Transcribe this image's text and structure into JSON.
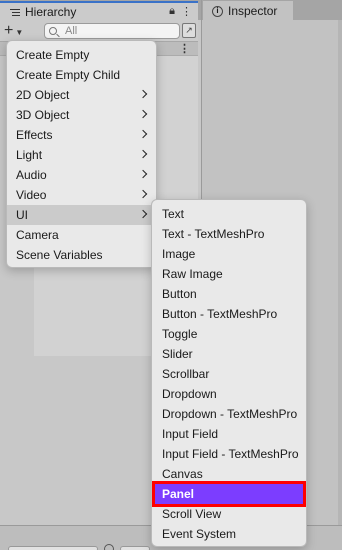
{
  "tabs": {
    "hierarchy": "Hierarchy",
    "inspector": "Inspector"
  },
  "toolbar": {
    "search_placeholder": "All"
  },
  "create_menu": {
    "items": [
      {
        "label": "Create Empty",
        "submenu": false
      },
      {
        "label": "Create Empty Child",
        "submenu": false
      },
      {
        "label": "2D Object",
        "submenu": true
      },
      {
        "label": "3D Object",
        "submenu": true
      },
      {
        "label": "Effects",
        "submenu": true
      },
      {
        "label": "Light",
        "submenu": true
      },
      {
        "label": "Audio",
        "submenu": true
      },
      {
        "label": "Video",
        "submenu": true
      },
      {
        "label": "UI",
        "submenu": true,
        "active": true
      },
      {
        "label": "Camera",
        "submenu": false
      },
      {
        "label": "Scene Variables",
        "submenu": false
      }
    ]
  },
  "ui_submenu": {
    "items": [
      {
        "label": "Text"
      },
      {
        "label": "Text - TextMeshPro"
      },
      {
        "label": "Image"
      },
      {
        "label": "Raw Image"
      },
      {
        "label": "Button"
      },
      {
        "label": "Button - TextMeshPro"
      },
      {
        "label": "Toggle"
      },
      {
        "label": "Slider"
      },
      {
        "label": "Scrollbar"
      },
      {
        "label": "Dropdown"
      },
      {
        "label": "Dropdown - TextMeshPro"
      },
      {
        "label": "Input Field"
      },
      {
        "label": "Input Field - TextMeshPro"
      },
      {
        "label": "Canvas"
      },
      {
        "label": "Panel",
        "selected": true
      },
      {
        "label": "Scroll View"
      },
      {
        "label": "Event System"
      }
    ]
  },
  "colors": {
    "selected_bg": "#7c3dff",
    "highlight_outline": "#ff0000",
    "tab_accent": "#3a72c8"
  }
}
